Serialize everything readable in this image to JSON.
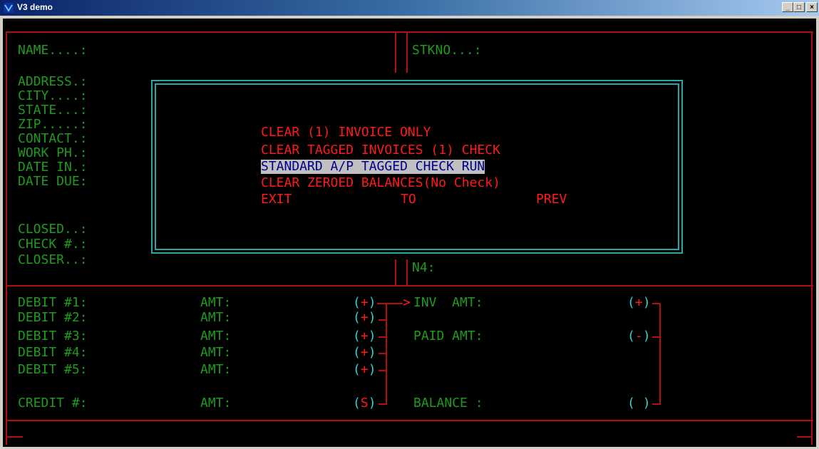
{
  "window": {
    "title": "V3 demo",
    "minimize": "_",
    "maximize": "□",
    "close": "×"
  },
  "customer_panel": {
    "labels": [
      "NAME....:",
      "ADDRESS.:",
      "CITY....:",
      "STATE...:",
      "ZIP.....:",
      "CONTACT.:",
      "WORK PH.:",
      "DATE IN.:",
      "DATE DUE:",
      "CLOSED..:",
      "CHECK #.:",
      "CLOSER..:"
    ]
  },
  "right_panel": {
    "stkno_label": "STKNO...:",
    "n4_label": "N4:"
  },
  "debits": [
    {
      "label": "DEBIT #1:",
      "amt_label": "AMT:",
      "sign": "(+)"
    },
    {
      "label": "DEBIT #2:",
      "amt_label": "AMT:",
      "sign": "(+)"
    },
    {
      "label": "DEBIT #3:",
      "amt_label": "AMT:",
      "sign": "(+)"
    },
    {
      "label": "DEBIT #4:",
      "amt_label": "AMT:",
      "sign": "(+)"
    },
    {
      "label": "DEBIT #5:",
      "amt_label": "AMT:",
      "sign": "(+)"
    }
  ],
  "credit": {
    "label": "CREDIT #:",
    "amt_label": "AMT:",
    "sign": "(S)"
  },
  "totals": {
    "inv_label": "INV  AMT:",
    "inv_sign": "(+)",
    "paid_label": "PAID AMT:",
    "paid_sign": "(-)",
    "balance_label": "BALANCE :",
    "balance_sign": "( )"
  },
  "menu": {
    "items": [
      {
        "label": "CLEAR (1) INVOICE ONLY",
        "selected": false
      },
      {
        "label": "CLEAR TAGGED INVOICES (1) CHECK",
        "selected": false
      },
      {
        "label": "STANDARD A/P TAGGED CHECK RUN",
        "selected": true
      },
      {
        "label": "CLEAR ZEROED BALANCES(No Check)",
        "selected": false
      }
    ],
    "exit_words": [
      "EXIT",
      "TO",
      "PREV"
    ]
  },
  "colors": {
    "label_green": "#1f9a1f",
    "border_red": "#b01010",
    "menu_red": "#ff1a1a",
    "dialog_cyan": "#2aa6a6",
    "sign_cyan": "#33d0d0",
    "highlight_bg": "#c0c0c0",
    "highlight_fg": "#00008b"
  }
}
